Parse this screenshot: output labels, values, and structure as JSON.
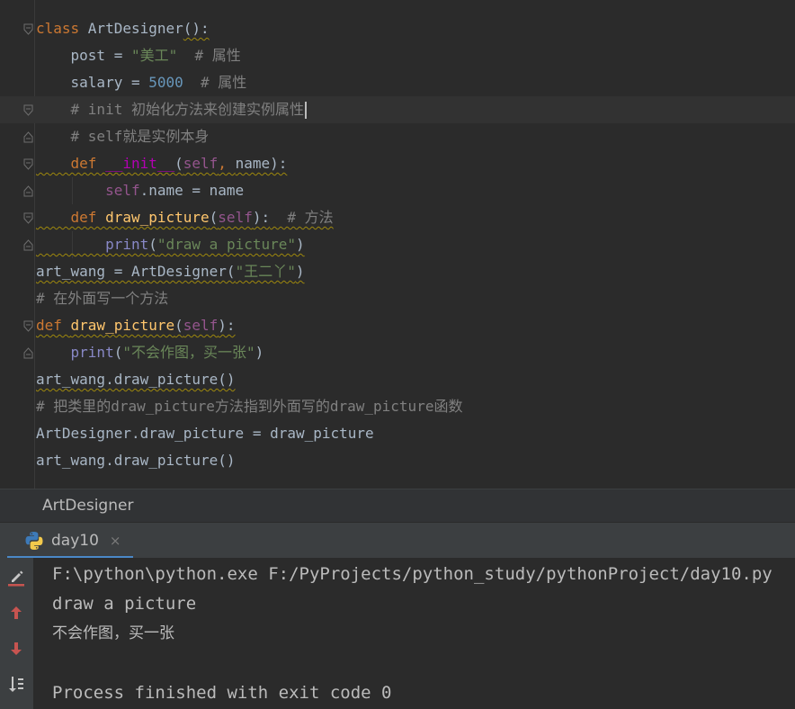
{
  "editor": {
    "lines": [
      {
        "parts": [
          [
            "kw",
            "class "
          ],
          [
            "cls",
            "ArtDesigner"
          ],
          [
            "wavy",
            "():"
          ]
        ]
      },
      {
        "parts": [
          [
            "plain",
            "    post = "
          ],
          [
            "str",
            "\"美工\""
          ],
          [
            "cmt",
            "  # 属性"
          ]
        ]
      },
      {
        "parts": [
          [
            "plain",
            "    salary = "
          ],
          [
            "num",
            "5000"
          ],
          [
            "cmt",
            "  # 属性"
          ]
        ]
      },
      {
        "parts": [
          [
            "cmt",
            "    # init 初始化方法来创建实例属性"
          ]
        ]
      },
      {
        "parts": [
          [
            "cmt",
            "    # self就是实例本身"
          ]
        ]
      },
      {
        "parts": [
          [
            "kw",
            "    def "
          ],
          [
            "dunder",
            "__init__"
          ],
          [
            "plain",
            "("
          ],
          [
            "self",
            "self"
          ],
          [
            "kw",
            ", "
          ],
          [
            "plain",
            "name):"
          ]
        ]
      },
      {
        "parts": [
          [
            "self",
            "        self"
          ],
          [
            "plain",
            ".name = name"
          ]
        ]
      },
      {
        "parts": [
          [
            "kw",
            "    def "
          ],
          [
            "fn",
            "draw_picture"
          ],
          [
            "plain",
            "("
          ],
          [
            "self",
            "self"
          ],
          [
            "plain",
            "):"
          ],
          [
            "cmt",
            "  # 方法"
          ]
        ]
      },
      {
        "parts": [
          [
            "builtin",
            "        print"
          ],
          [
            "plain",
            "("
          ],
          [
            "str",
            "\"draw a picture\""
          ],
          [
            "plain",
            ")"
          ]
        ]
      },
      {
        "parts": [
          [
            "plain",
            "art_wang = ArtDesigner("
          ],
          [
            "str",
            "\"王二丫\""
          ],
          [
            "plain",
            ")"
          ]
        ]
      },
      {
        "parts": [
          [
            "cmt",
            "# 在外面写一个方法"
          ]
        ]
      },
      {
        "parts": [
          [
            "kw",
            "def "
          ],
          [
            "fn",
            "draw_picture"
          ],
          [
            "plain",
            "("
          ],
          [
            "self",
            "self"
          ],
          [
            "plain",
            "):"
          ]
        ]
      },
      {
        "parts": [
          [
            "builtin",
            "    print"
          ],
          [
            "plain",
            "("
          ],
          [
            "str",
            "\"不会作图，买一张\""
          ],
          [
            "plain",
            ")"
          ]
        ]
      },
      {
        "parts": [
          [
            "plain",
            "art_wang.draw_picture()"
          ]
        ]
      },
      {
        "parts": [
          [
            "cmt",
            "# 把类里的draw_picture方法指到外面写的draw_picture函数"
          ]
        ]
      },
      {
        "parts": [
          [
            "plain",
            "ArtDesigner.draw_picture = draw_picture"
          ]
        ]
      },
      {
        "parts": [
          [
            "plain",
            "art_wang.draw_picture()"
          ]
        ]
      }
    ]
  },
  "breadcrumb": {
    "text": "ArtDesigner"
  },
  "run_tab": {
    "label": "day10",
    "close": "×",
    "icon": "python-icon"
  },
  "console": {
    "lines": [
      "F:\\python\\python.exe F:/PyProjects/python_study/pythonProject/day10.py",
      "draw a picture",
      "不会作图，买一张",
      "",
      "Process finished with exit code 0"
    ]
  },
  "toolbar": {
    "icons": [
      "edit-pencil-icon",
      "up-arrow-icon",
      "down-arrow-icon",
      "sort-icon"
    ]
  },
  "colors": {
    "editor_bg": "#2b2b2b",
    "keyword": "#cc7832",
    "string": "#6a8759",
    "number": "#6897bb",
    "comment": "#808080",
    "function": "#ffc66d",
    "self": "#94558d",
    "dunder": "#b200b2",
    "builtin": "#8888c6",
    "tab_underline": "#4a88c7"
  }
}
